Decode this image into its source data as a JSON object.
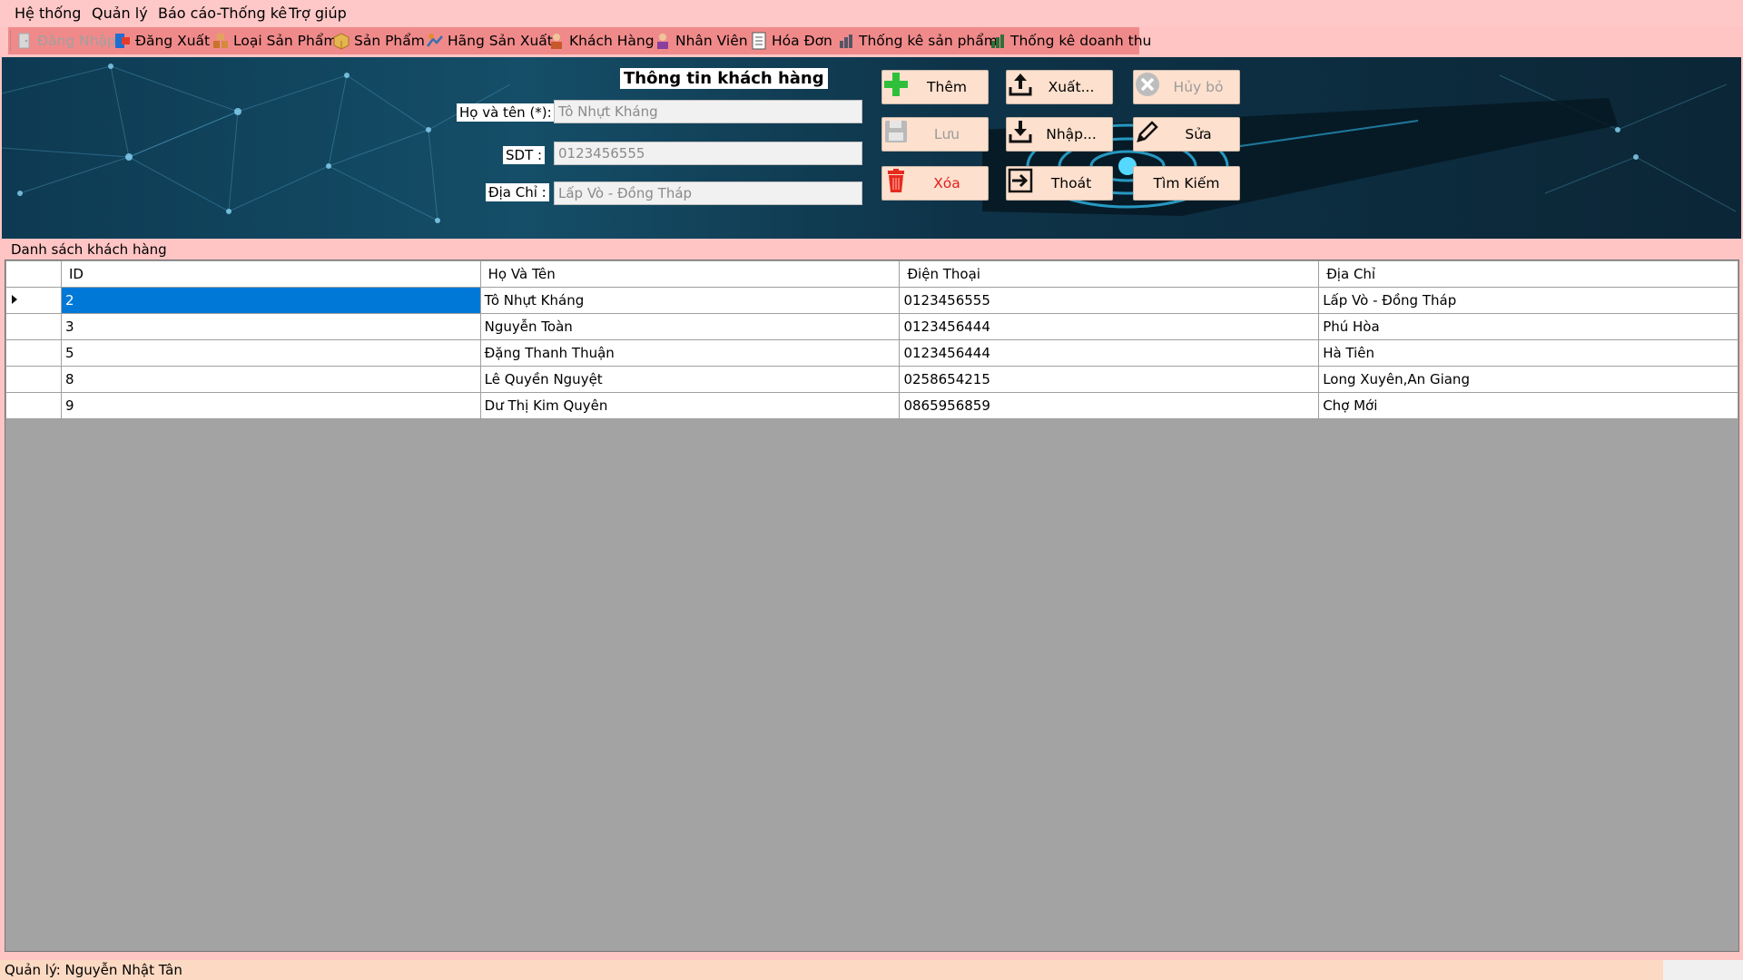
{
  "menu": [
    "Hệ thống",
    "Quản lý",
    "Báo cáo-Thống kê",
    "Trợ giúp"
  ],
  "toolbar": [
    {
      "label": "Đăng Nhập",
      "icon": "login-icon",
      "disabled": true
    },
    {
      "label": "Đăng Xuất",
      "icon": "logout-icon",
      "disabled": false
    },
    {
      "label": "Loại Sản Phẩm",
      "icon": "product-category-icon",
      "disabled": false
    },
    {
      "label": "Sản Phẩm",
      "icon": "product-box-icon",
      "disabled": false
    },
    {
      "label": "Hãng Sản Xuất",
      "icon": "manufacturer-icon",
      "disabled": false
    },
    {
      "label": "Khách Hàng",
      "icon": "customer-icon",
      "disabled": false
    },
    {
      "label": "Nhân Viên",
      "icon": "employee-icon",
      "disabled": false
    },
    {
      "label": "Hóa Đơn",
      "icon": "invoice-icon",
      "disabled": false
    },
    {
      "label": "Thống kê sản phẩm",
      "icon": "product-stats-icon",
      "disabled": false
    },
    {
      "label": "Thống kê doanh thu",
      "icon": "revenue-stats-icon",
      "disabled": false
    }
  ],
  "form": {
    "title": "Thông tin khách hàng",
    "name_label": "Họ và tên (*):",
    "name_value": "Tô Nhựt Kháng",
    "phone_label": "SDT :",
    "phone_value": "0123456555",
    "address_label": "Địa Chỉ :",
    "address_value": "Lấp Vò - Đồng Tháp"
  },
  "buttons": {
    "add": "Thêm",
    "export": "Xuất...",
    "cancel": "Hủy bỏ",
    "save": "Lưu",
    "import": "Nhập...",
    "edit": "Sửa",
    "delete": "Xóa",
    "exit": "Thoát",
    "search": "Tìm Kiếm"
  },
  "grid": {
    "caption": "Danh sách khách hàng",
    "columns": [
      "ID",
      "Họ Và Tên",
      "Điện Thoại",
      "Địa Chỉ"
    ],
    "rows": [
      [
        "2",
        "Tô Nhựt Kháng",
        "0123456555",
        "Lấp Vò - Đồng Tháp"
      ],
      [
        "3",
        "Nguyễn Toàn",
        "0123456444",
        "Phú Hòa"
      ],
      [
        "5",
        "Đặng Thanh Thuận",
        "0123456444",
        "Hà Tiên"
      ],
      [
        "8",
        "Lê Quyền Nguyệt",
        "0258654215",
        "Long Xuyên,An Giang"
      ],
      [
        "9",
        "Dư Thị Kim Quyên",
        "0865956859",
        "Chợ Mới"
      ]
    ],
    "selected_row": 0
  },
  "status": "Quản lý: Nguyễn Nhật Tân"
}
